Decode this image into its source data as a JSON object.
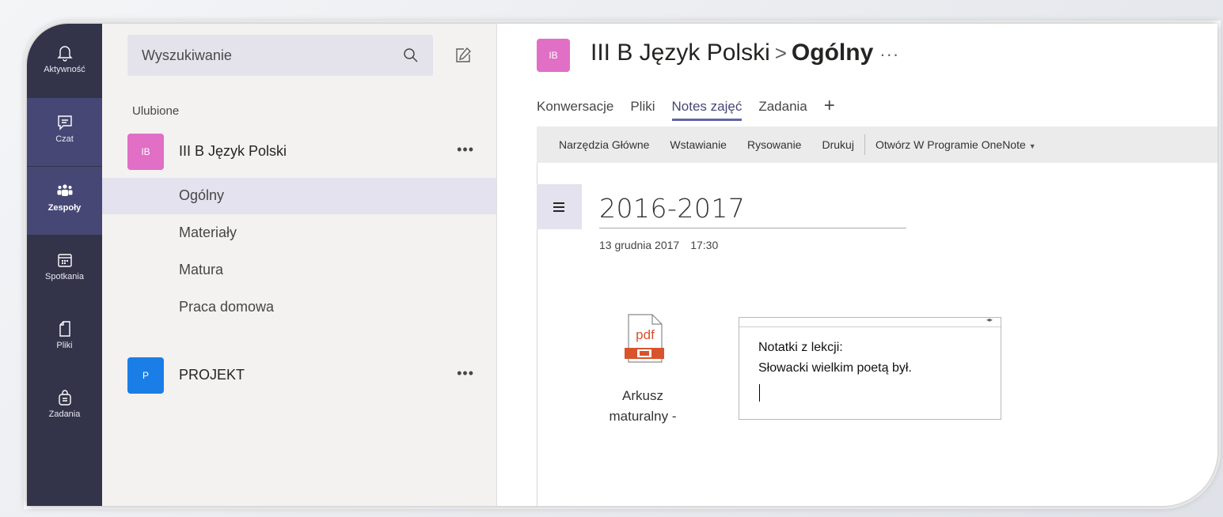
{
  "rail": {
    "items": [
      {
        "label": "Aktywność",
        "icon": "bell-icon"
      },
      {
        "label": "Czat",
        "icon": "chat-icon"
      },
      {
        "label": "Zespoły",
        "icon": "teams-icon"
      },
      {
        "label": "Spotkania",
        "icon": "calendar-icon"
      },
      {
        "label": "Pliki",
        "icon": "file-icon"
      },
      {
        "label": "Zadania",
        "icon": "assignments-icon"
      }
    ]
  },
  "sidebar": {
    "search_placeholder": "Wyszukiwanie",
    "favorites_label": "Ulubione",
    "teams": [
      {
        "initials": "IB",
        "name": "III B Język Polski",
        "color": "#e06fc5",
        "more": "•••"
      },
      {
        "initials": "P",
        "name": "PROJEKT",
        "color": "#1b7ee7",
        "more": "•••"
      }
    ],
    "channels": [
      "Ogólny",
      "Materiały",
      "Matura",
      "Praca domowa"
    ]
  },
  "header": {
    "avatar_initials": "IB",
    "team": "III B Język Polski",
    "separator": ">",
    "channel": "Ogólny",
    "more": "···"
  },
  "tabs": [
    {
      "label": "Konwersacje"
    },
    {
      "label": "Pliki"
    },
    {
      "label": "Notes zajęć"
    },
    {
      "label": "Zadania"
    }
  ],
  "tab_add": "+",
  "ribbon": {
    "items": [
      "Narzędzia Główne",
      "Wstawianie",
      "Rysowanie",
      "Drukuj"
    ],
    "open_in": "Otwórz W Programie OneNote",
    "open_caret": "▼"
  },
  "page": {
    "nav_icon": "hamburger-icon",
    "title": "2016-2017",
    "date": "13 grudnia 2017",
    "time": "17:30"
  },
  "attachment": {
    "type_label": "pdf",
    "name_line1": "Arkusz",
    "name_line2": "maturalny -"
  },
  "note": {
    "resize_glyph": "◂▸",
    "line1": "Notatki z lekcji:",
    "line2": "Słowacki wielkim poetą był."
  },
  "colors": {
    "rail_bg": "#33344a",
    "rail_active": "#464775",
    "accent": "#6264a7",
    "team_pink": "#e06fc5",
    "team_blue": "#1b7ee7",
    "pdf_red": "#d9532c"
  }
}
